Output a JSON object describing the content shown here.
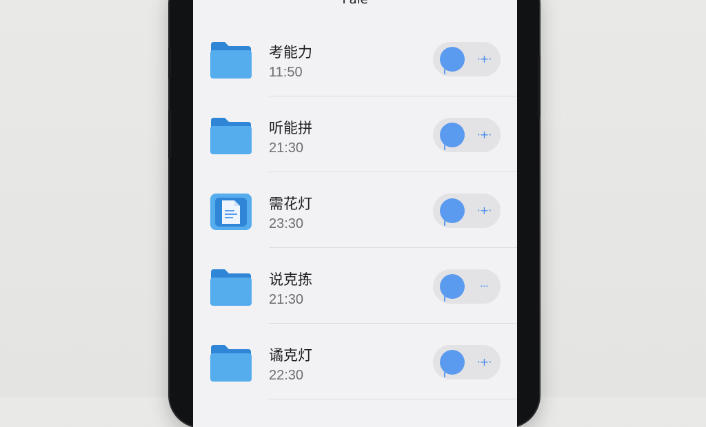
{
  "header": {
    "title": "Pale"
  },
  "files": [
    {
      "title": "考能力",
      "time": "11:50",
      "icon": "folder-icon",
      "more_glyph": "·+·"
    },
    {
      "title": "听能拼",
      "time": "21:30",
      "icon": "folder-icon",
      "more_glyph": "·+·"
    },
    {
      "title": "需花灯",
      "time": "23:30",
      "icon": "document-icon",
      "more_glyph": "·+·"
    },
    {
      "title": "说克拣",
      "time": "21:30",
      "icon": "folder-icon",
      "more_glyph": "···"
    },
    {
      "title": "谲克灯",
      "time": "22:30",
      "icon": "folder-icon",
      "more_glyph": "·+·"
    }
  ],
  "colors": {
    "accent": "#5b9bef",
    "folder_body": "#56adee",
    "folder_tab": "#2f86d6"
  }
}
